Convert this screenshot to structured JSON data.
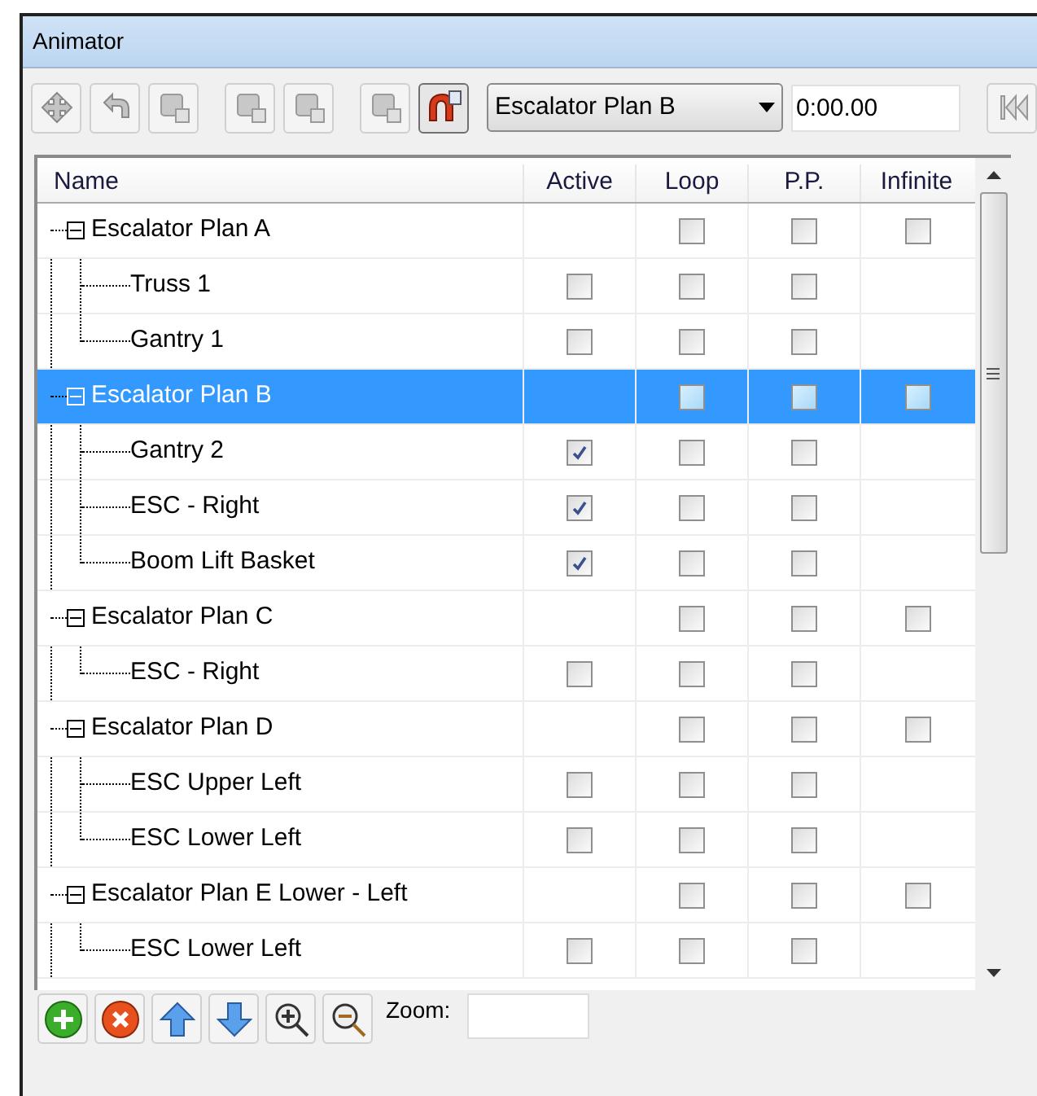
{
  "window": {
    "title": "Animator"
  },
  "toolbar": {
    "animation_select": "Escalator Plan B",
    "time_field": "0:00.00"
  },
  "table": {
    "columns": [
      "Name",
      "Active",
      "Loop",
      "P.P.",
      "Infinite"
    ],
    "groups": [
      {
        "name": "Escalator Plan A",
        "expanded": true,
        "selected": false,
        "loop": false,
        "pp": false,
        "infinite": false,
        "children": [
          {
            "name": "Truss 1",
            "selected": false,
            "active": false,
            "loop": false,
            "pp": false
          },
          {
            "name": "Gantry 1",
            "selected": false,
            "active": false,
            "loop": false,
            "pp": false
          }
        ]
      },
      {
        "name": "Escalator Plan B",
        "expanded": true,
        "selected": true,
        "loop": false,
        "pp": false,
        "infinite": false,
        "children": [
          {
            "name": "Gantry 2",
            "selected": false,
            "active": true,
            "loop": false,
            "pp": false
          },
          {
            "name": "ESC  - Right",
            "selected": false,
            "active": true,
            "loop": false,
            "pp": false
          },
          {
            "name": "Boom Lift Basket",
            "selected": false,
            "active": true,
            "loop": false,
            "pp": false
          }
        ]
      },
      {
        "name": "Escalator Plan C",
        "expanded": true,
        "selected": false,
        "loop": false,
        "pp": false,
        "infinite": false,
        "children": [
          {
            "name": "ESC  - Right",
            "selected": false,
            "active": false,
            "loop": false,
            "pp": false
          }
        ]
      },
      {
        "name": "Escalator Plan D",
        "expanded": true,
        "selected": false,
        "loop": false,
        "pp": false,
        "infinite": false,
        "children": [
          {
            "name": "ESC Upper Left",
            "selected": false,
            "active": false,
            "loop": false,
            "pp": false
          },
          {
            "name": "ESC Lower Left",
            "selected": false,
            "active": false,
            "loop": false,
            "pp": false
          }
        ]
      },
      {
        "name": "Escalator Plan E Lower - Left",
        "expanded": true,
        "selected": false,
        "loop": false,
        "pp": false,
        "infinite": false,
        "children": [
          {
            "name": "ESC Lower Left",
            "selected": false,
            "active": false,
            "loop": false,
            "pp": false
          }
        ]
      }
    ]
  },
  "bottom_bar": {
    "zoom_label": "Zoom:"
  }
}
